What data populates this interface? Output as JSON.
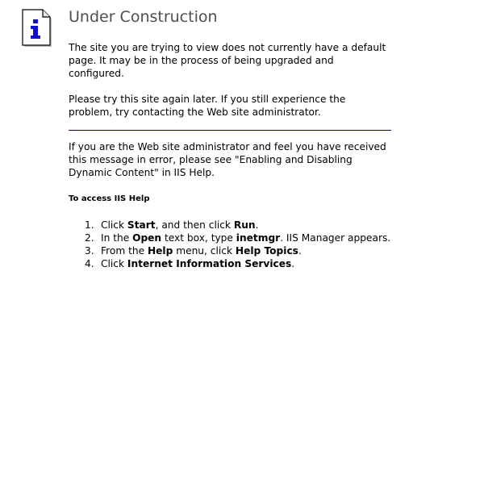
{
  "icon": "info-icon",
  "title": "Under Construction",
  "intro": {
    "p1": "The site you are trying to view does not currently have a default page. It may be in the process of being upgraded and configured.",
    "p2": "Please try this site again later. If you still experience the problem, try contacting the Web site administrator."
  },
  "admin_note": "If you are the Web site administrator and feel you have received this message in error, please see \"Enabling and Disabling Dynamic Content\" in IIS Help.",
  "help": {
    "heading": "To access IIS Help",
    "steps": [
      {
        "num": "1.",
        "pre": "Click ",
        "b1": "Start",
        "mid": ", and then click ",
        "b2": "Run",
        "post": "."
      },
      {
        "num": "2.",
        "pre": "In the ",
        "b1": "Open",
        "mid": " text box, type ",
        "b2": "inetmgr",
        "post": ". IIS Manager appears."
      },
      {
        "num": "3.",
        "pre": "From the ",
        "b1": "Help",
        "mid": " menu, click ",
        "b2": "Help Topics",
        "post": "."
      },
      {
        "num": "4.",
        "pre": "Click ",
        "b1": "Internet Information Services",
        "mid": "",
        "b2": "",
        "post": "."
      }
    ]
  },
  "colors": {
    "title": "#4e4e4e",
    "icon_glyph": "#1010c8",
    "divider": "#000066"
  }
}
